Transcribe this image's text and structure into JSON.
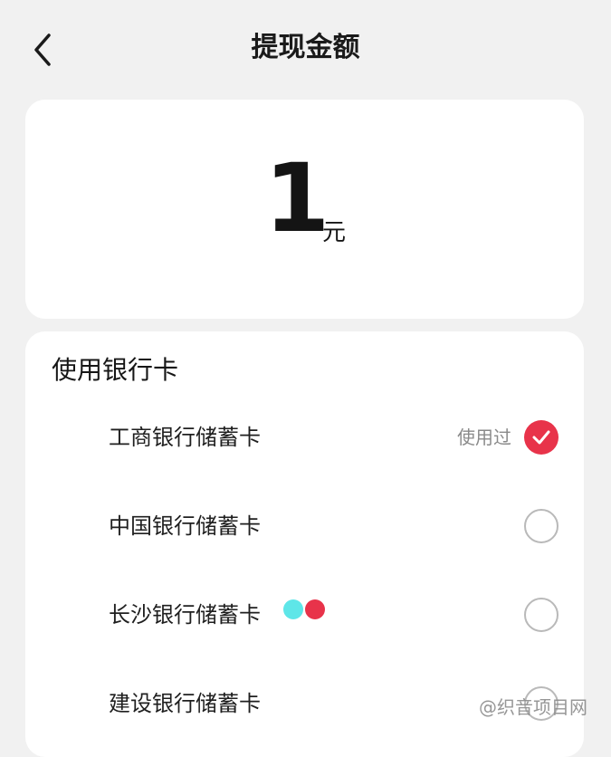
{
  "header": {
    "title": "提现金额",
    "back_icon": "chevron-left-icon"
  },
  "amount": {
    "value": "1",
    "unit": "元"
  },
  "bank_section": {
    "title": "使用银行卡",
    "accent_color": "#e8334a",
    "items": [
      {
        "name": "工商银行储蓄卡",
        "tag": "使用过",
        "selected": true
      },
      {
        "name": "中国银行储蓄卡",
        "tag": "",
        "selected": false
      },
      {
        "name": "长沙银行储蓄卡",
        "tag": "",
        "selected": false
      },
      {
        "name": "建设银行储蓄卡",
        "tag": "",
        "selected": false
      }
    ]
  },
  "watermark": "@织音项目网"
}
